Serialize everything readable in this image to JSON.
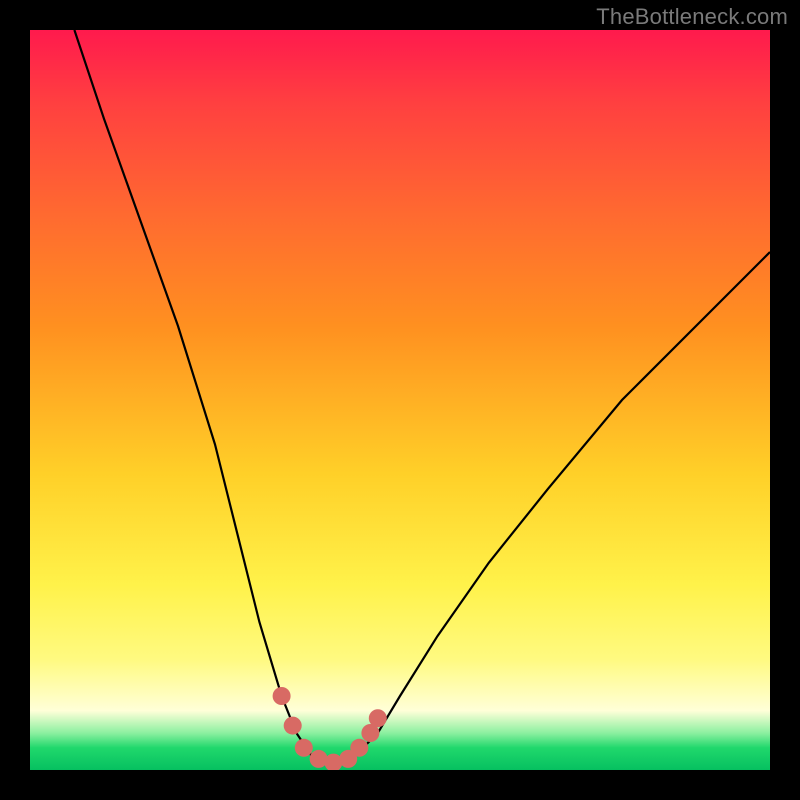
{
  "watermark": {
    "text": "TheBottleneck.com"
  },
  "chart_data": {
    "type": "line",
    "title": "",
    "xlabel": "",
    "ylabel": "",
    "xlim": [
      0,
      100
    ],
    "ylim": [
      0,
      100
    ],
    "series": [
      {
        "name": "bottleneck-curve",
        "x": [
          6,
          10,
          15,
          20,
          25,
          28,
          31,
          34,
          36,
          38,
          40,
          42,
          44,
          47,
          50,
          55,
          62,
          70,
          80,
          90,
          100
        ],
        "values": [
          100,
          88,
          74,
          60,
          44,
          32,
          20,
          10,
          5,
          2,
          1,
          1,
          2,
          5,
          10,
          18,
          28,
          38,
          50,
          60,
          70
        ]
      }
    ],
    "markers": {
      "name": "highlight-dots",
      "color": "#d86a64",
      "x": [
        34,
        35.5,
        37,
        39,
        41,
        43,
        44.5,
        46,
        47
      ],
      "values": [
        10,
        6,
        3,
        1.5,
        1,
        1.5,
        3,
        5,
        7
      ]
    }
  }
}
